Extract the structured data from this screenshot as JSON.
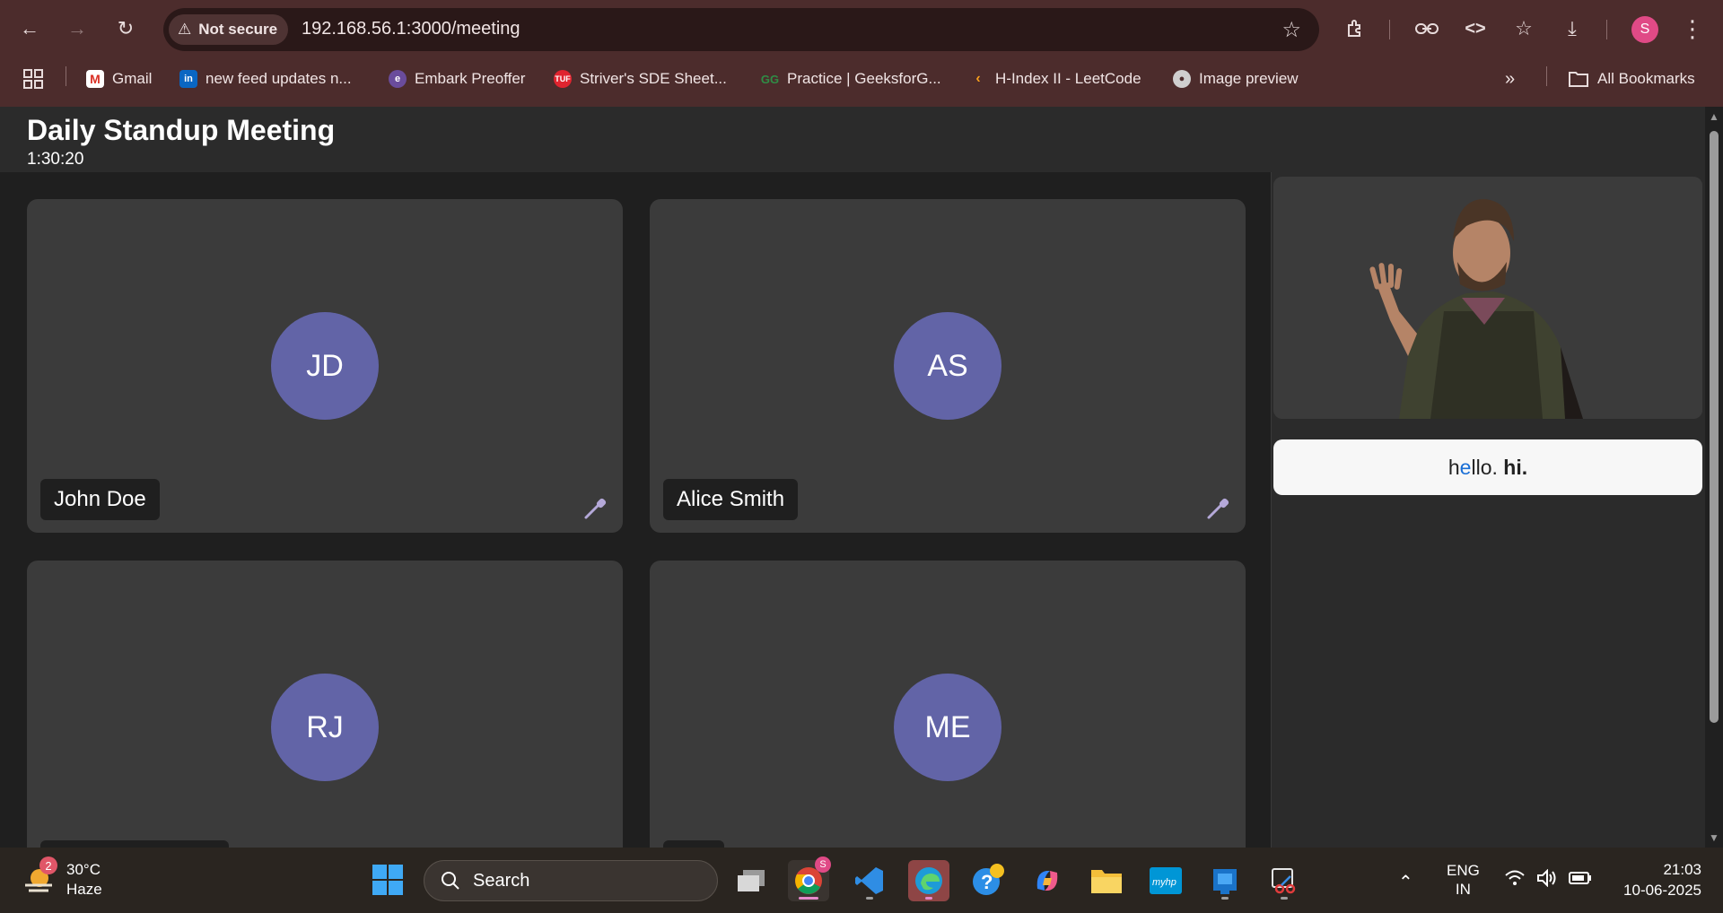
{
  "browser": {
    "security_label": "Not secure",
    "url": "192.168.56.1:3000/meeting",
    "profile_initial": "S",
    "bookmarks": [
      {
        "label": "Gmail"
      },
      {
        "label": "new feed updates n..."
      },
      {
        "label": "Embark Preoffer"
      },
      {
        "label": "Striver's SDE Sheet..."
      },
      {
        "label": "Practice | GeeksforG..."
      },
      {
        "label": "H-Index II - LeetCode"
      },
      {
        "label": "Image preview"
      }
    ],
    "all_bookmarks": "All Bookmarks"
  },
  "meeting": {
    "title": "Daily Standup Meeting",
    "timer": "1:30:20",
    "participants": [
      {
        "initials": "JD",
        "name": "John Doe"
      },
      {
        "initials": "AS",
        "name": "Alice Smith"
      },
      {
        "initials": "RJ",
        "name": ""
      },
      {
        "initials": "ME",
        "name": ""
      }
    ],
    "caption": {
      "part1": "h",
      "highlight": "e",
      "part2": "llo. ",
      "bold": "hi."
    }
  },
  "taskbar": {
    "weather_temp": "30°C",
    "weather_desc": "Haze",
    "weather_badge": "2",
    "search_label": "Search",
    "chrome_badge": "S",
    "lang_top": "ENG",
    "lang_bottom": "IN",
    "time": "21:03",
    "date": "10-06-2025"
  }
}
